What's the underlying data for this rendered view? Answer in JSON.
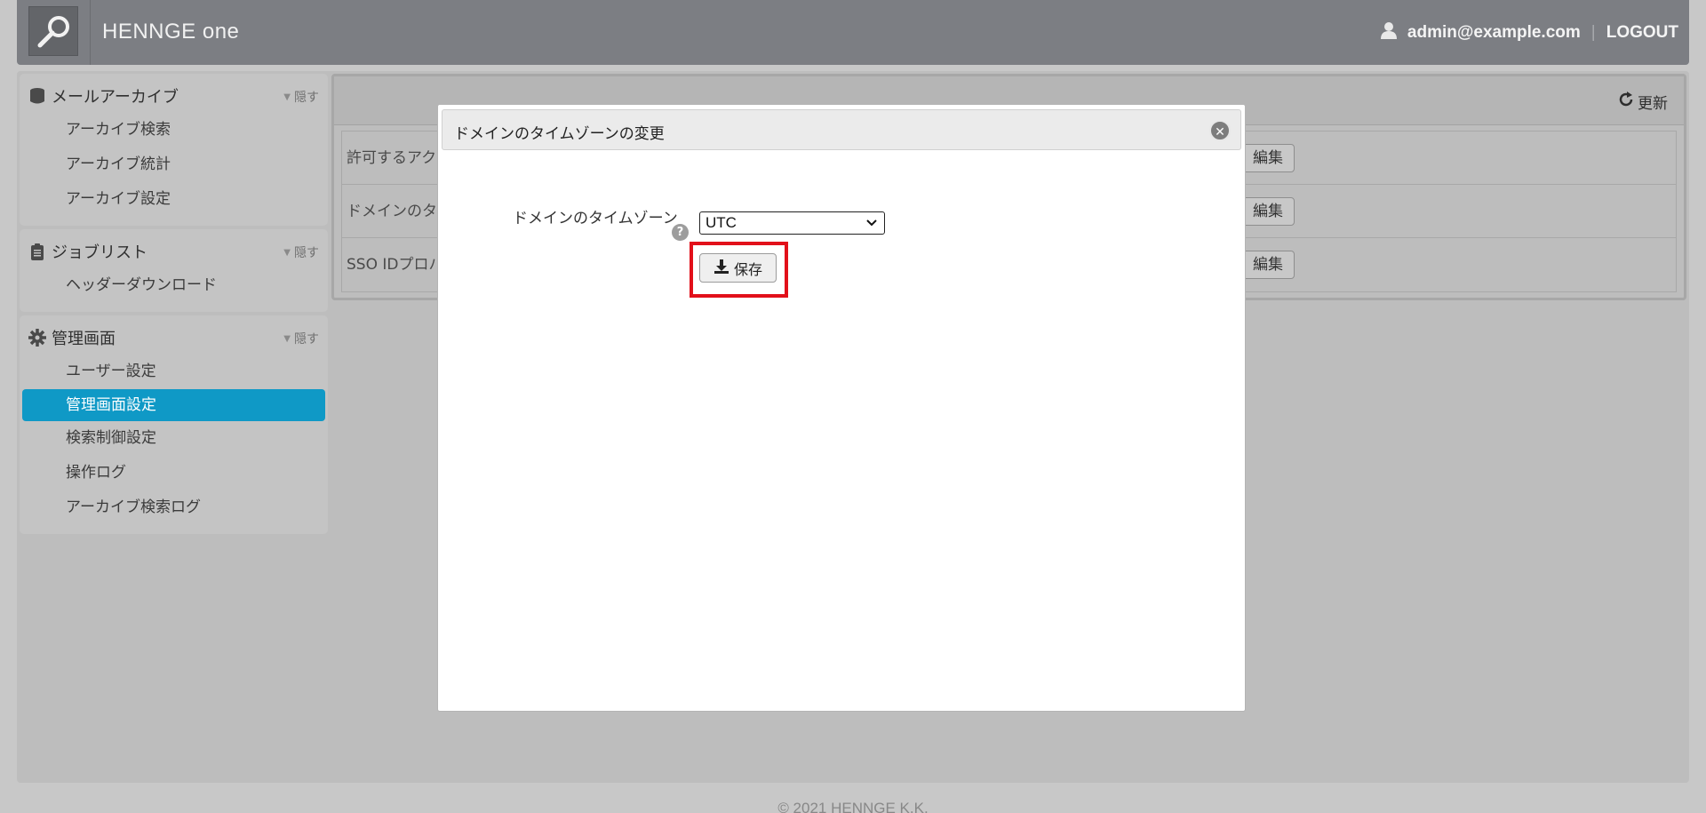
{
  "header": {
    "brand": "HENNGE one",
    "user_email": "admin@example.com",
    "separator": "|",
    "logout_label": "LOGOUT"
  },
  "sidebar": {
    "hide_label": "隠す",
    "sections": [
      {
        "title": "メールアーカイブ",
        "icon": "database-icon",
        "items": [
          "アーカイブ検索",
          "アーカイブ統計",
          "アーカイブ設定"
        ]
      },
      {
        "title": "ジョブリスト",
        "icon": "clipboard-icon",
        "items": [
          "ヘッダーダウンロード"
        ]
      },
      {
        "title": "管理画面",
        "icon": "gear-icon",
        "items": [
          "ユーザー設定",
          "管理画面設定",
          "検索制御設定",
          "操作ログ",
          "アーカイブ検索ログ"
        ],
        "active_item": "管理画面設定"
      }
    ]
  },
  "content": {
    "refresh_label": "更新",
    "rows": [
      {
        "label": "許可するアク",
        "edit_label": "編集"
      },
      {
        "label": "ドメインのタ",
        "edit_label": "編集"
      },
      {
        "label": "SSO IDプロバ",
        "edit_label": "編集"
      }
    ]
  },
  "modal": {
    "title": "ドメインのタイムゾーンの変更",
    "field_label": "ドメインのタイムゾーン",
    "help_icon_text": "?",
    "timezone_value": "UTC",
    "save_label": "保存"
  },
  "footer": {
    "copyright": "© 2021 HENNGE K.K."
  },
  "colors": {
    "accent_active": "#33c3ea",
    "highlight_border": "#e2101a",
    "header_bg": "#7c7e83"
  }
}
